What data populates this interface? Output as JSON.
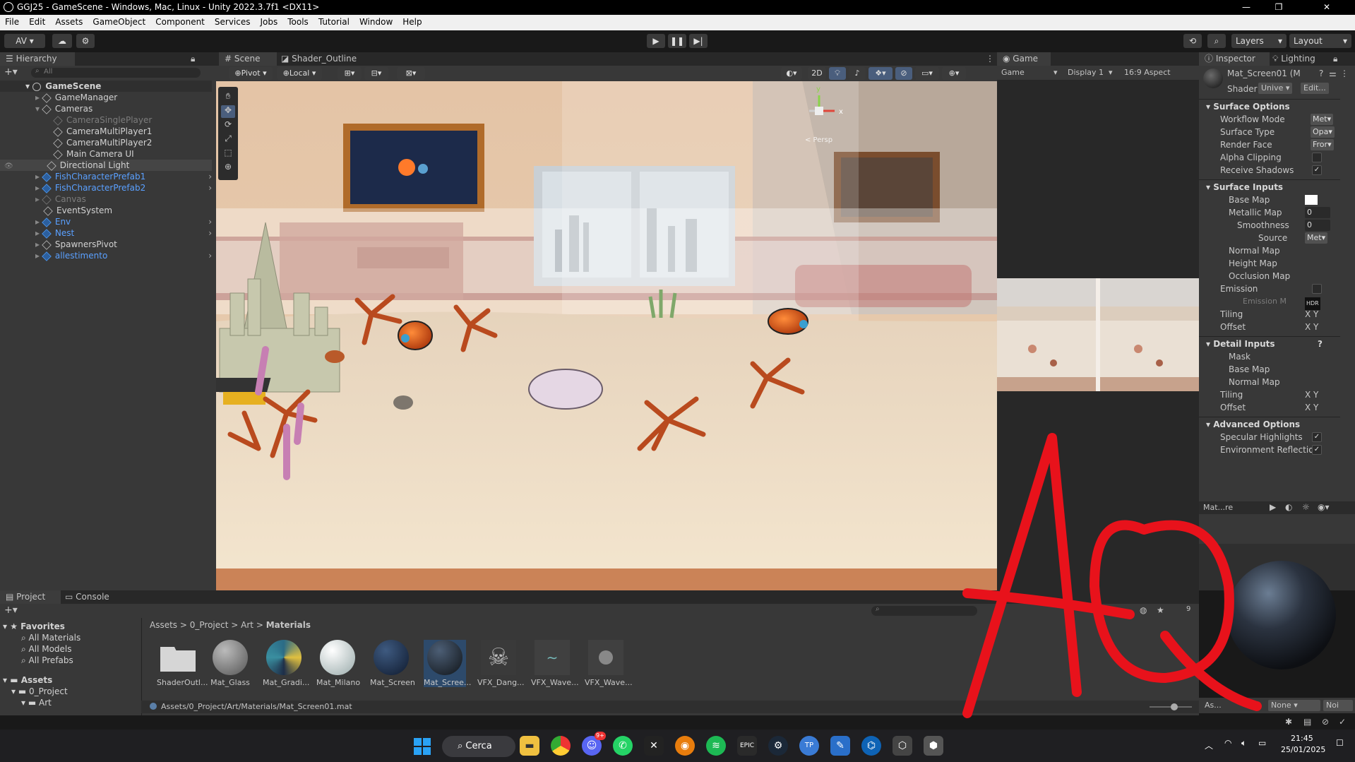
{
  "window": {
    "title": "GGJ25 - GameScene - Windows, Mac, Linux - Unity 2022.3.7f1 <DX11>"
  },
  "menu": [
    "File",
    "Edit",
    "Assets",
    "GameObject",
    "Component",
    "Services",
    "Jobs",
    "Tools",
    "Tutorial",
    "Window",
    "Help"
  ],
  "toolbar": {
    "account": "AV",
    "layers": "Layers",
    "layout": "Layout"
  },
  "hierarchy": {
    "tab": "Hierarchy",
    "search_placeholder": "All",
    "scene": "GameScene",
    "items": [
      {
        "label": "GameManager"
      },
      {
        "label": "Cameras"
      },
      {
        "label": "CameraSinglePlayer"
      },
      {
        "label": "CameraMultiPlayer1"
      },
      {
        "label": "CameraMultiPlayer2"
      },
      {
        "label": "Main Camera UI"
      },
      {
        "label": "Directional Light"
      },
      {
        "label": "FishCharacterPrefab1"
      },
      {
        "label": "FishCharacterPrefab2"
      },
      {
        "label": "Canvas"
      },
      {
        "label": "EventSystem"
      },
      {
        "label": "Env"
      },
      {
        "label": "Nest"
      },
      {
        "label": "SpawnersPivot"
      },
      {
        "label": "allestimento"
      }
    ]
  },
  "scene": {
    "tabs": [
      "Scene",
      "Shader_Outline"
    ],
    "pivot": "Pivot",
    "space": "Local",
    "mode2d": "2D",
    "persp": "< Persp",
    "gizmo_x": "x",
    "gizmo_y": "y"
  },
  "game": {
    "tab": "Game",
    "view": "Game",
    "display": "Display 1",
    "aspect": "16:9 Aspect"
  },
  "inspector": {
    "tabs": [
      "Inspector",
      "Lighting"
    ],
    "material_name": "Mat_Screen01 (M",
    "shader_label": "Shader",
    "shader_value": "Unive",
    "edit_button": "Edit...",
    "sections": {
      "surface_options": "Surface Options",
      "surface_inputs": "Surface Inputs",
      "detail_inputs": "Detail Inputs",
      "advanced_options": "Advanced Options"
    },
    "surface_options": [
      {
        "label": "Workflow Mode",
        "value": "Met"
      },
      {
        "label": "Surface Type",
        "value": "Opa"
      },
      {
        "label": "Render Face",
        "value": "Fror"
      },
      {
        "label": "Alpha Clipping",
        "value": ""
      },
      {
        "label": "Receive Shadows",
        "value": "✓"
      }
    ],
    "surface_inputs": [
      {
        "label": "Base Map",
        "value": ""
      },
      {
        "label": "Metallic Map",
        "value": "0"
      },
      {
        "label": "Smoothness",
        "value": "0"
      },
      {
        "label": "Source",
        "value": "Met"
      },
      {
        "label": "Normal Map",
        "value": ""
      },
      {
        "label": "Height Map",
        "value": ""
      },
      {
        "label": "Occlusion Map",
        "value": ""
      },
      {
        "label": "Emission",
        "value": ""
      },
      {
        "label": "Emission M",
        "value": "HDR"
      },
      {
        "label": "Tiling",
        "value": "X  Y"
      },
      {
        "label": "Offset",
        "value": "X  Y"
      }
    ],
    "detail_inputs": [
      {
        "label": "Mask"
      },
      {
        "label": "Base Map"
      },
      {
        "label": "Normal Map"
      },
      {
        "label": "Tiling",
        "value": "X  Y"
      },
      {
        "label": "Offset",
        "value": "X  Y"
      }
    ],
    "advanced_options": [
      {
        "label": "Specular Highlights",
        "value": "✓"
      },
      {
        "label": "Environment Reflectio",
        "value": "✓"
      }
    ],
    "preview_title": "Mat...re",
    "asset_bundle_label": "As...",
    "asset_bundle_value": "None",
    "asset_variant": "Noi"
  },
  "project": {
    "tabs": [
      "Project",
      "Console"
    ],
    "favorites": "Favorites",
    "fav_items": [
      "All Materials",
      "All Models",
      "All Prefabs"
    ],
    "assets_root": "Assets",
    "tree": [
      "0_Project",
      "Art"
    ],
    "breadcrumb": [
      "Assets",
      "0_Project",
      "Art",
      "Materials"
    ],
    "assets": [
      {
        "name": "ShaderOutl...",
        "kind": "folder"
      },
      {
        "name": "Mat_Glass",
        "kind": "grey"
      },
      {
        "name": "Mat_Gradi...",
        "kind": "gradient"
      },
      {
        "name": "Mat_Milano",
        "kind": "white"
      },
      {
        "name": "Mat_Screen",
        "kind": "navy"
      },
      {
        "name": "Mat_Scree...",
        "kind": "dark"
      },
      {
        "name": "VFX_Dang...",
        "kind": "skull"
      },
      {
        "name": "VFX_Wave...",
        "kind": "wave"
      },
      {
        "name": "VFX_Wave...",
        "kind": "dot"
      }
    ],
    "status_path": "Assets/0_Project/Art/Materials/Mat_Screen01.mat",
    "count": "9"
  },
  "taskbar": {
    "search": "Cerca",
    "time": "21:45",
    "date": "25/01/2025",
    "icons": [
      "files-icon",
      "chrome-icon",
      "discord-icon",
      "whatsapp-icon",
      "epic-arrow-icon",
      "blender-icon",
      "spotify-icon",
      "epic-games-icon",
      "steam-icon",
      "tp-icon",
      "paint-icon",
      "vscode-icon",
      "unity-hub-icon",
      "unity-icon"
    ],
    "badge_discord": "9+"
  },
  "overlay_signature": "AQ",
  "colors": {
    "prefab_blue": "#5aa0ff",
    "panel": "#383838",
    "dark": "#191919",
    "signature_red": "#e8121b"
  }
}
